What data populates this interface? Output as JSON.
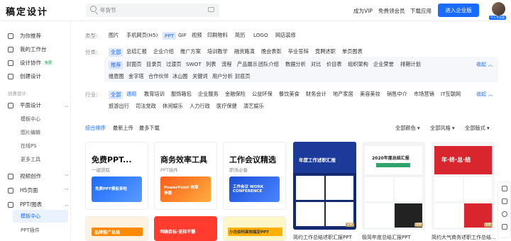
{
  "header": {
    "logo": "稿定设计",
    "search_placeholder": "年货节",
    "nav": [
      "成为VIP",
      "免费领会员",
      "下载应用"
    ],
    "enter_btn": "进入企业版",
    "avatar_tag": "个人专业版"
  },
  "sidebar": {
    "top_items": [
      {
        "label": "为你推荐",
        "icon": "recommend-icon"
      },
      {
        "label": "我的工作台",
        "icon": "workspace-icon"
      },
      {
        "label": "设计协作",
        "icon": "collab-icon",
        "badge": "免费"
      },
      {
        "label": "创建设计",
        "icon": "create-icon"
      }
    ],
    "section_label": "创意设计",
    "groups": [
      {
        "label": "平面设计",
        "icon": "graphic-icon",
        "children": [
          "模板中心",
          "图片编辑",
          "在线PS",
          "更多工具"
        ]
      },
      {
        "label": "视频创作",
        "icon": "video-icon"
      },
      {
        "label": "H5页面",
        "icon": "h5-icon"
      },
      {
        "label": "PPT/图表",
        "icon": "ppt-icon",
        "children": [
          "模板中心",
          "PPT插件"
        ]
      }
    ]
  },
  "filters": {
    "type_label": "类型:",
    "types": [
      "图片",
      "手机网页(H5)",
      "PPT",
      "GIF",
      "视频",
      "印刷物料",
      "简历",
      "LOGO",
      "网店装修"
    ],
    "category_label": "分类:",
    "categories_row1": [
      "全部",
      "总结汇报",
      "企业介绍",
      "推广方案",
      "培训教学",
      "融资路演",
      "晚会表彰",
      "毕业答辩",
      "竞聘述职",
      "单页图表"
    ],
    "categories_row2": [
      "推荐",
      "封面页",
      "目录页",
      "过渡页",
      "SWOT",
      "列表",
      "流程",
      "产品展示",
      "团队介绍",
      "数据分析",
      "对比",
      "价目表",
      "组织架构",
      "企业荣誉",
      "排期计划"
    ],
    "categories_row3": [
      "维恩图",
      "金字塔",
      "合作伙伴",
      "冰山图",
      "关键词",
      "用户分析",
      "封底页"
    ],
    "collapse": "收起",
    "industry_label": "行业:",
    "industries_row1": [
      "全部",
      "通用",
      "教育培训",
      "服饰箱包",
      "企业服务",
      "金融保险",
      "公益环保",
      "餐饮美食",
      "财务会计",
      "地产家居",
      "美容美妆",
      "销售中介",
      "市场营销",
      "IT互联网"
    ],
    "industries_row2": [
      "旅游出行",
      "司法党政",
      "休闲娱乐",
      "人力行政",
      "医疗保健",
      "演艺娱乐"
    ]
  },
  "sort": {
    "tabs": [
      "综合排序",
      "最新上传",
      "最多下载"
    ],
    "dropdowns": [
      "全部颜色",
      "全部风格",
      "全部版式"
    ]
  },
  "promos": [
    {
      "title": "免费PPT...",
      "subtitle": "一键获取",
      "banner": "免费PPT模板来啦"
    },
    {
      "title": "商务效率工具",
      "subtitle": "PPT插件",
      "banner": "PowerPoint 效率神器"
    },
    {
      "title": "工作会议精选",
      "subtitle": "职场必备",
      "banner": "工作会议 WORK CONFERENCE"
    }
  ],
  "templates": [
    {
      "caption": "简约工作总结述职汇报PPT",
      "headline": "年度工作述职汇报"
    },
    {
      "caption": "极简年度总结汇报PPT",
      "headline": "2020年度总结汇报"
    },
    {
      "caption": "简约大气商务述职工作总结...",
      "headline": "年·终·总·结"
    }
  ],
  "row2": [
    {
      "banner": "品牌推广总结"
    },
    {
      "banner": "明确目标·坚持不懈"
    },
    {
      "banner": "小白如何高效搞定PPT"
    }
  ],
  "vip": "VIP",
  "colors": {
    "accent": "#1a6bff",
    "promo_blue": "#1a6bff",
    "promo_orange": "#ff7a1a",
    "red_tpl": "#d9262e"
  }
}
